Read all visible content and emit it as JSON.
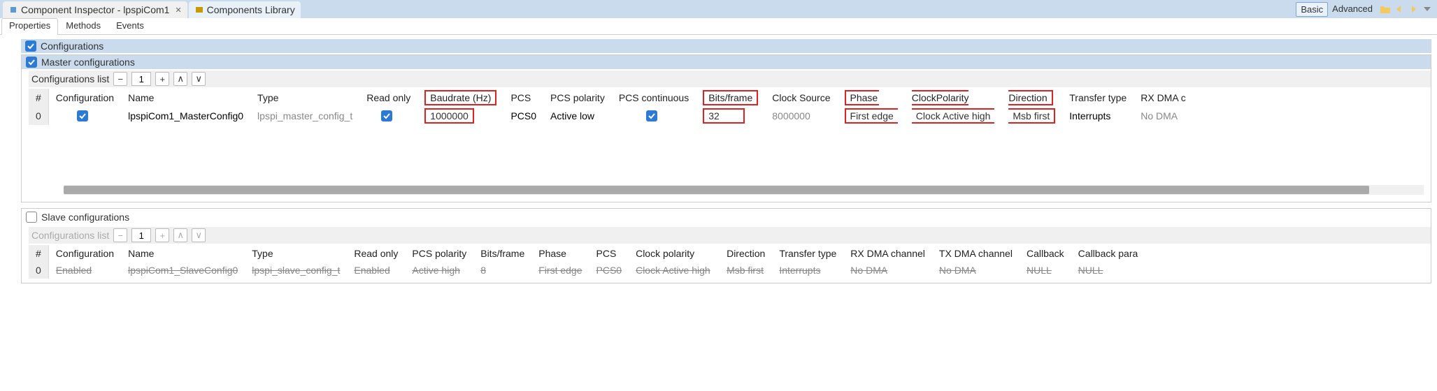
{
  "top_tabs": {
    "inspector": "Component Inspector - lpspiCom1",
    "library": "Components Library"
  },
  "basic": "Basic",
  "advanced": "Advanced",
  "sub_tabs": {
    "properties": "Properties",
    "methods": "Methods",
    "events": "Events"
  },
  "sections": {
    "configurations": "Configurations",
    "master": "Master configurations",
    "slave": "Slave configurations",
    "list": "Configurations list"
  },
  "toolbar": {
    "count": "1"
  },
  "master_headers": {
    "row": "#",
    "config": "Configuration",
    "name": "Name",
    "type": "Type",
    "readonly": "Read only",
    "baud": "Baudrate (Hz)",
    "pcs": "PCS",
    "pcspol": "PCS polarity",
    "pcscont": "PCS continuous",
    "bits": "Bits/frame",
    "clocksrc": "Clock Source",
    "phase": "Phase",
    "clockpol": "ClockPolarity",
    "dir": "Direction",
    "transfer": "Transfer type",
    "rxdma": "RX DMA c"
  },
  "master_row": {
    "row": "0",
    "name": "lpspiCom1_MasterConfig0",
    "type": "lpspi_master_config_t",
    "baud": "1000000",
    "pcs": "PCS0",
    "pcspol": "Active low",
    "bits": "32",
    "clocksrc": "8000000",
    "phase": "First edge",
    "clockpol": "Clock Active high",
    "dir": "Msb first",
    "transfer": "Interrupts",
    "rxdma": "No DMA"
  },
  "slave_headers": {
    "row": "#",
    "config": "Configuration",
    "name": "Name",
    "type": "Type",
    "readonly": "Read only",
    "pcspol": "PCS polarity",
    "bits": "Bits/frame",
    "phase": "Phase",
    "pcs": "PCS",
    "clockpol": "Clock polarity",
    "dir": "Direction",
    "transfer": "Transfer type",
    "rxdma": "RX DMA channel",
    "txdma": "TX DMA channel",
    "callback": "Callback",
    "callbackparam": "Callback para"
  },
  "slave_row": {
    "row": "0",
    "config": "Enabled",
    "name": "lpspiCom1_SlaveConfig0",
    "type": "lpspi_slave_config_t",
    "readonly": "Enabled",
    "pcspol": "Active high",
    "bits": "8",
    "phase": "First edge",
    "pcs": "PCS0",
    "clockpol": "Clock Active high",
    "dir": "Msb first",
    "transfer": "Interrupts",
    "rxdma": "No DMA",
    "txdma": "No DMA",
    "callback": "NULL",
    "callbackparam": "NULL"
  }
}
